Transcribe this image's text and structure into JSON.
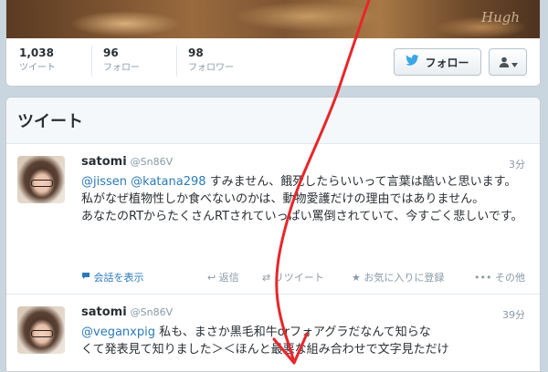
{
  "profile": {
    "banner_signature": "Hugh",
    "stats": [
      {
        "value": "1,038",
        "label": "ツイート"
      },
      {
        "value": "96",
        "label": "フォロー"
      },
      {
        "value": "98",
        "label": "フォロワー"
      }
    ],
    "follow_label": "フォロー"
  },
  "tweets_section": {
    "title": "ツイート"
  },
  "tweets": [
    {
      "name": "satomi",
      "handle": "@Sn86V",
      "time": "3分",
      "mentions": [
        "@jissen",
        "@katana298"
      ],
      "text_line1": "すみません、餓死したらいいって言葉は酷い",
      "text_rest": "と思います。私がなぜ植物性しか食べないのかは、動物愛護だけの理由ではありません。",
      "text_para2": "あなたのRTからたくさんRTされていっぱい罵倒されていて、今すごく悲しいです。",
      "actions": {
        "expand": "会話を表示",
        "reply": "返信",
        "retweet": "リツイート",
        "favorite": "お気に入りに登録",
        "more": "その他"
      }
    },
    {
      "name": "satomi",
      "handle": "@Sn86V",
      "time": "39分",
      "mention": "@veganxpig",
      "text_line1": "私も、まさか黒毛和牛orフォアグラだなんて知らな",
      "text_line2": "くて発表見て知りました＞＜ほんと最悪な組み合わせで文字見ただけ"
    }
  ],
  "colors": {
    "link": "#2b7bb9",
    "annotation_arrow": "#e8262a"
  }
}
